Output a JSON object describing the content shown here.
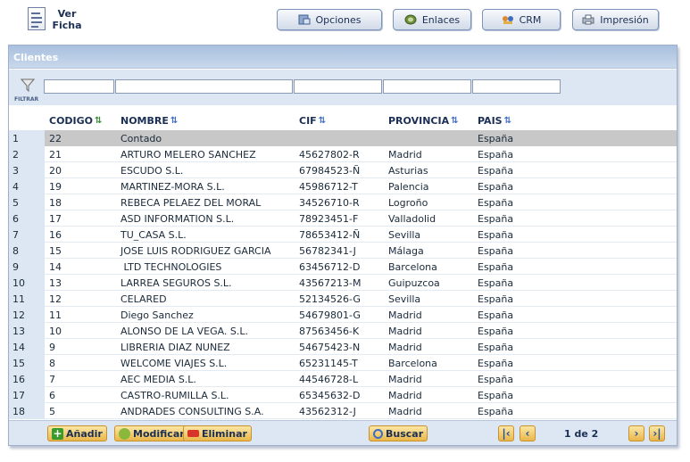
{
  "view_toggle": {
    "line1": "Ver",
    "line2": "Ficha"
  },
  "toolbar": {
    "opciones": "Opciones",
    "enlaces": "Enlaces",
    "crm": "CRM",
    "impresion": "Impresión"
  },
  "panel": {
    "title": "Clientes"
  },
  "filter": {
    "label": "FILTRAR",
    "values": [
      "",
      "",
      "",
      "",
      ""
    ]
  },
  "columns": {
    "codigo": "CODIGO",
    "nombre": "NOMBRE",
    "cif": "CIF",
    "provincia": "PROVINCIA",
    "pais": "PAIS"
  },
  "rows": [
    {
      "n": "1",
      "codigo": "22",
      "nombre": "Contado",
      "cif": "",
      "provincia": "",
      "pais": "España"
    },
    {
      "n": "2",
      "codigo": "21",
      "nombre": "ARTURO MELERO SANCHEZ",
      "cif": "45627802-R",
      "provincia": "Madrid",
      "pais": "España"
    },
    {
      "n": "3",
      "codigo": "20",
      "nombre": "ESCUDO S.L.",
      "cif": "67984523-Ñ",
      "provincia": "Asturias",
      "pais": "España"
    },
    {
      "n": "4",
      "codigo": "19",
      "nombre": "MARTINEZ-MORA S.L.",
      "cif": "45986712-T",
      "provincia": "Palencia",
      "pais": "España"
    },
    {
      "n": "5",
      "codigo": "18",
      "nombre": "REBECA PELAEZ DEL MORAL",
      "cif": "34526710-R",
      "provincia": "Logroño",
      "pais": "España"
    },
    {
      "n": "6",
      "codigo": "17",
      "nombre": "ASD INFORMATION S.L.",
      "cif": "78923451-F",
      "provincia": "Valladolid",
      "pais": "España"
    },
    {
      "n": "7",
      "codigo": "16",
      "nombre": "TU_CASA S.L.",
      "cif": "78653412-Ñ",
      "provincia": "Sevilla",
      "pais": "España"
    },
    {
      "n": "8",
      "codigo": "15",
      "nombre": "JOSE LUIS RODRIGUEZ GARCIA",
      "cif": "56782341-J",
      "provincia": "Málaga",
      "pais": "España"
    },
    {
      "n": "9",
      "codigo": "14",
      "nombre": " LTD TECHNOLOGIES",
      "cif": "63456712-D",
      "provincia": "Barcelona",
      "pais": "España"
    },
    {
      "n": "10",
      "codigo": "13",
      "nombre": "LARREA SEGUROS S.L.",
      "cif": "43567213-M",
      "provincia": "Guipuzcoa",
      "pais": "España"
    },
    {
      "n": "11",
      "codigo": "12",
      "nombre": "CELARED",
      "cif": "52134526-G",
      "provincia": "Sevilla",
      "pais": "España"
    },
    {
      "n": "12",
      "codigo": "11",
      "nombre": "Diego Sanchez",
      "cif": "54679801-G",
      "provincia": "Madrid",
      "pais": "España"
    },
    {
      "n": "13",
      "codigo": "10",
      "nombre": "ALONSO DE LA VEGA. S.L.",
      "cif": "87563456-K",
      "provincia": "Madrid",
      "pais": "España"
    },
    {
      "n": "14",
      "codigo": "9",
      "nombre": "LIBRERIA DIAZ NUNEZ",
      "cif": "54675423-N",
      "provincia": "Madrid",
      "pais": "España"
    },
    {
      "n": "15",
      "codigo": "8",
      "nombre": "WELCOME VIAJES S.L.",
      "cif": "65231145-T",
      "provincia": "Barcelona",
      "pais": "España"
    },
    {
      "n": "16",
      "codigo": "7",
      "nombre": "AEC MEDIA S.L.",
      "cif": "44546728-L",
      "provincia": "Madrid",
      "pais": "España"
    },
    {
      "n": "17",
      "codigo": "6",
      "nombre": "CASTRO-RUMILLA S.L.",
      "cif": "65345632-D",
      "provincia": "Madrid",
      "pais": "España"
    },
    {
      "n": "18",
      "codigo": "5",
      "nombre": "ANDRADES CONSULTING S.A.",
      "cif": "43562312-J",
      "provincia": "Madrid",
      "pais": "España"
    }
  ],
  "footer": {
    "add": "Añadir",
    "modify": "Modificar",
    "delete": "Eliminar",
    "search": "Buscar",
    "page_info": "1 de 2"
  },
  "colors": {
    "accent": "#a8bfde",
    "selected_row": "#c8c8c8",
    "button_gold": "#e9b64a",
    "header_text": "#1b2f55"
  },
  "icons": [
    "document-icon",
    "options-icon",
    "links-icon",
    "crm-icon",
    "print-icon",
    "filter-funnel-icon",
    "sort-icon",
    "add-icon",
    "modify-icon",
    "delete-icon",
    "search-icon",
    "first-page-icon",
    "prev-page-icon",
    "next-page-icon",
    "last-page-icon"
  ]
}
